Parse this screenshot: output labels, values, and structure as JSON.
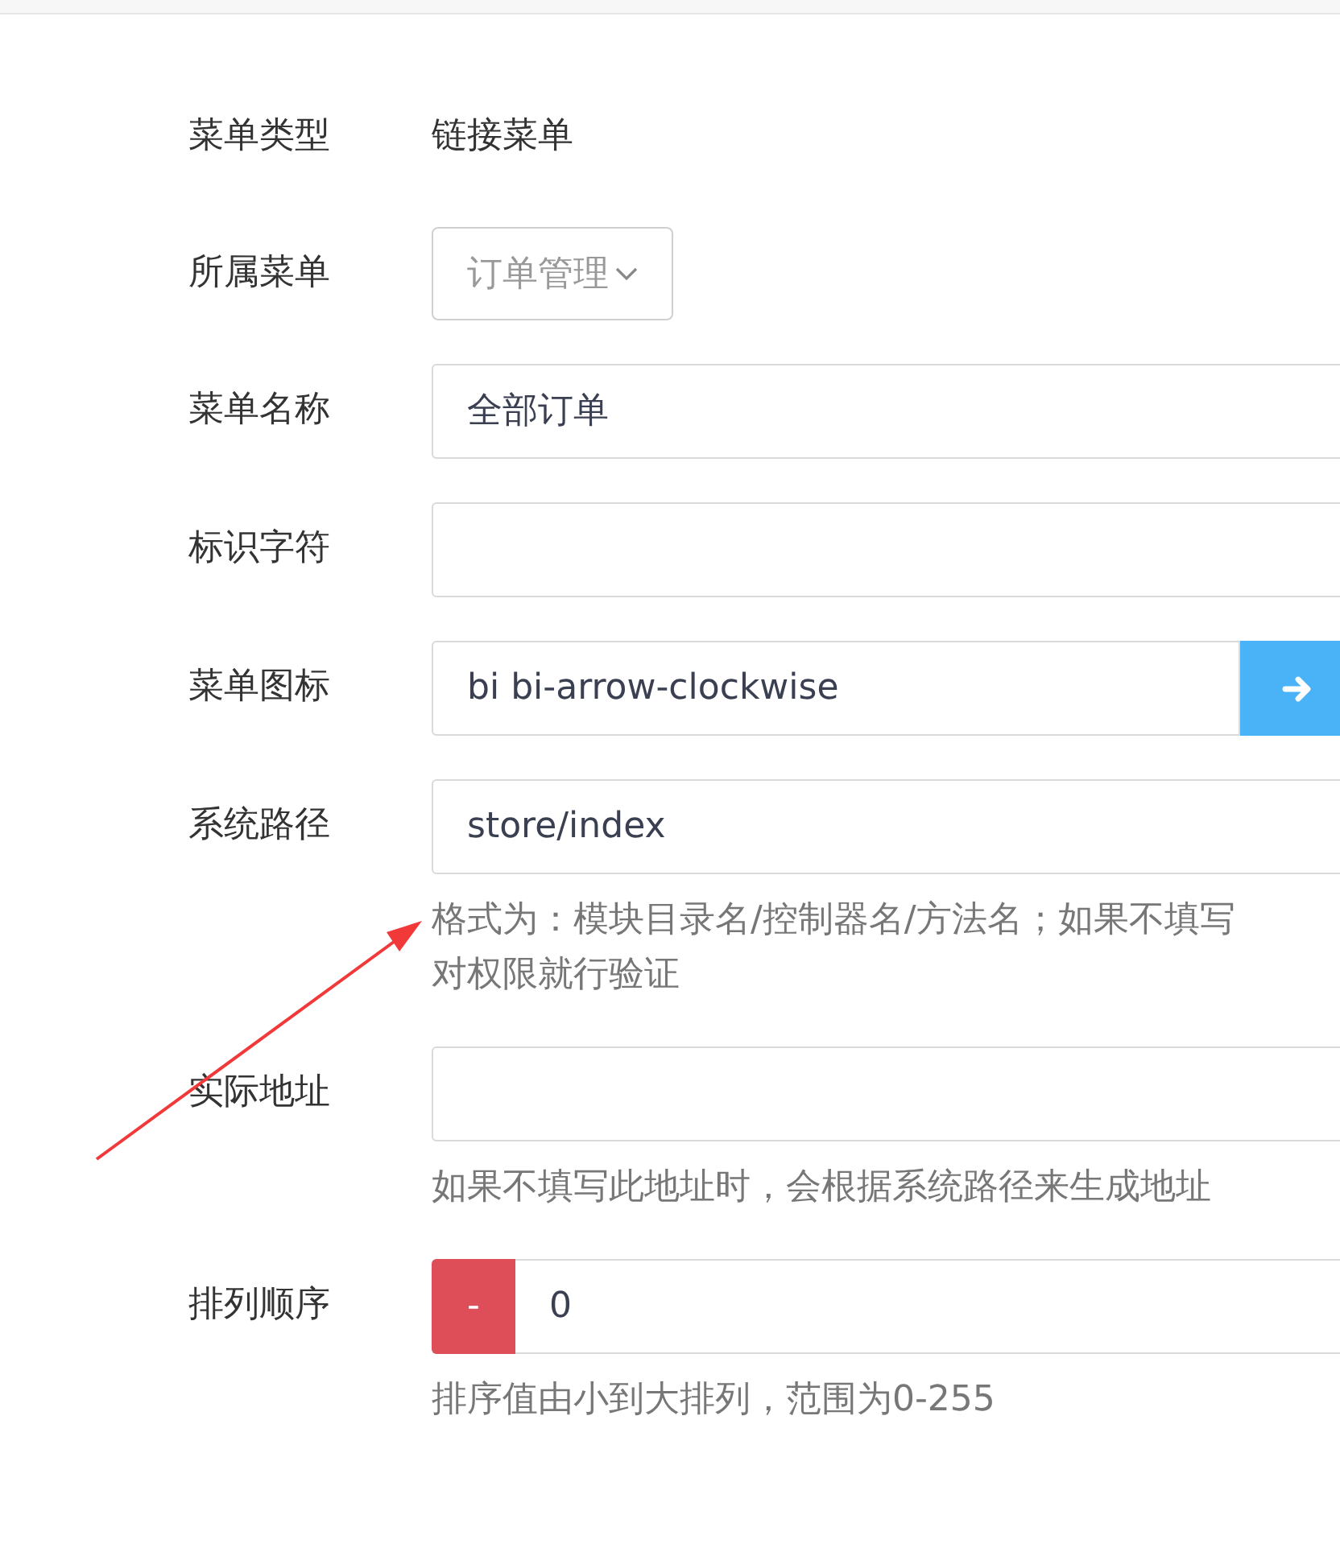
{
  "fields": [
    {
      "label": "菜单类型",
      "kind": "text",
      "value": "链接菜单"
    },
    {
      "label": "所属菜单",
      "kind": "select",
      "value": "订单管理"
    },
    {
      "label": "菜单名称",
      "kind": "input",
      "value": "全部订单"
    },
    {
      "label": "标识字符",
      "kind": "input"
    },
    {
      "label": "菜单图标",
      "kind": "icon_input",
      "value": "bi bi-arrow-clockwise"
    },
    {
      "label": "系统路径",
      "kind": "input",
      "value": "store/index",
      "help": [
        "格式为：模块目录名/控制器名/方法名；如果不填写",
        "对权限就行验证"
      ]
    },
    {
      "label": "实际地址",
      "kind": "input",
      "help": [
        "如果不填写此地址时，会根据系统路径来生成地址"
      ]
    },
    {
      "label": "排列顺序",
      "kind": "stepper",
      "button": "-",
      "value": "0",
      "help": [
        "排序值由小到大排列，范围为0-255"
      ]
    }
  ]
}
